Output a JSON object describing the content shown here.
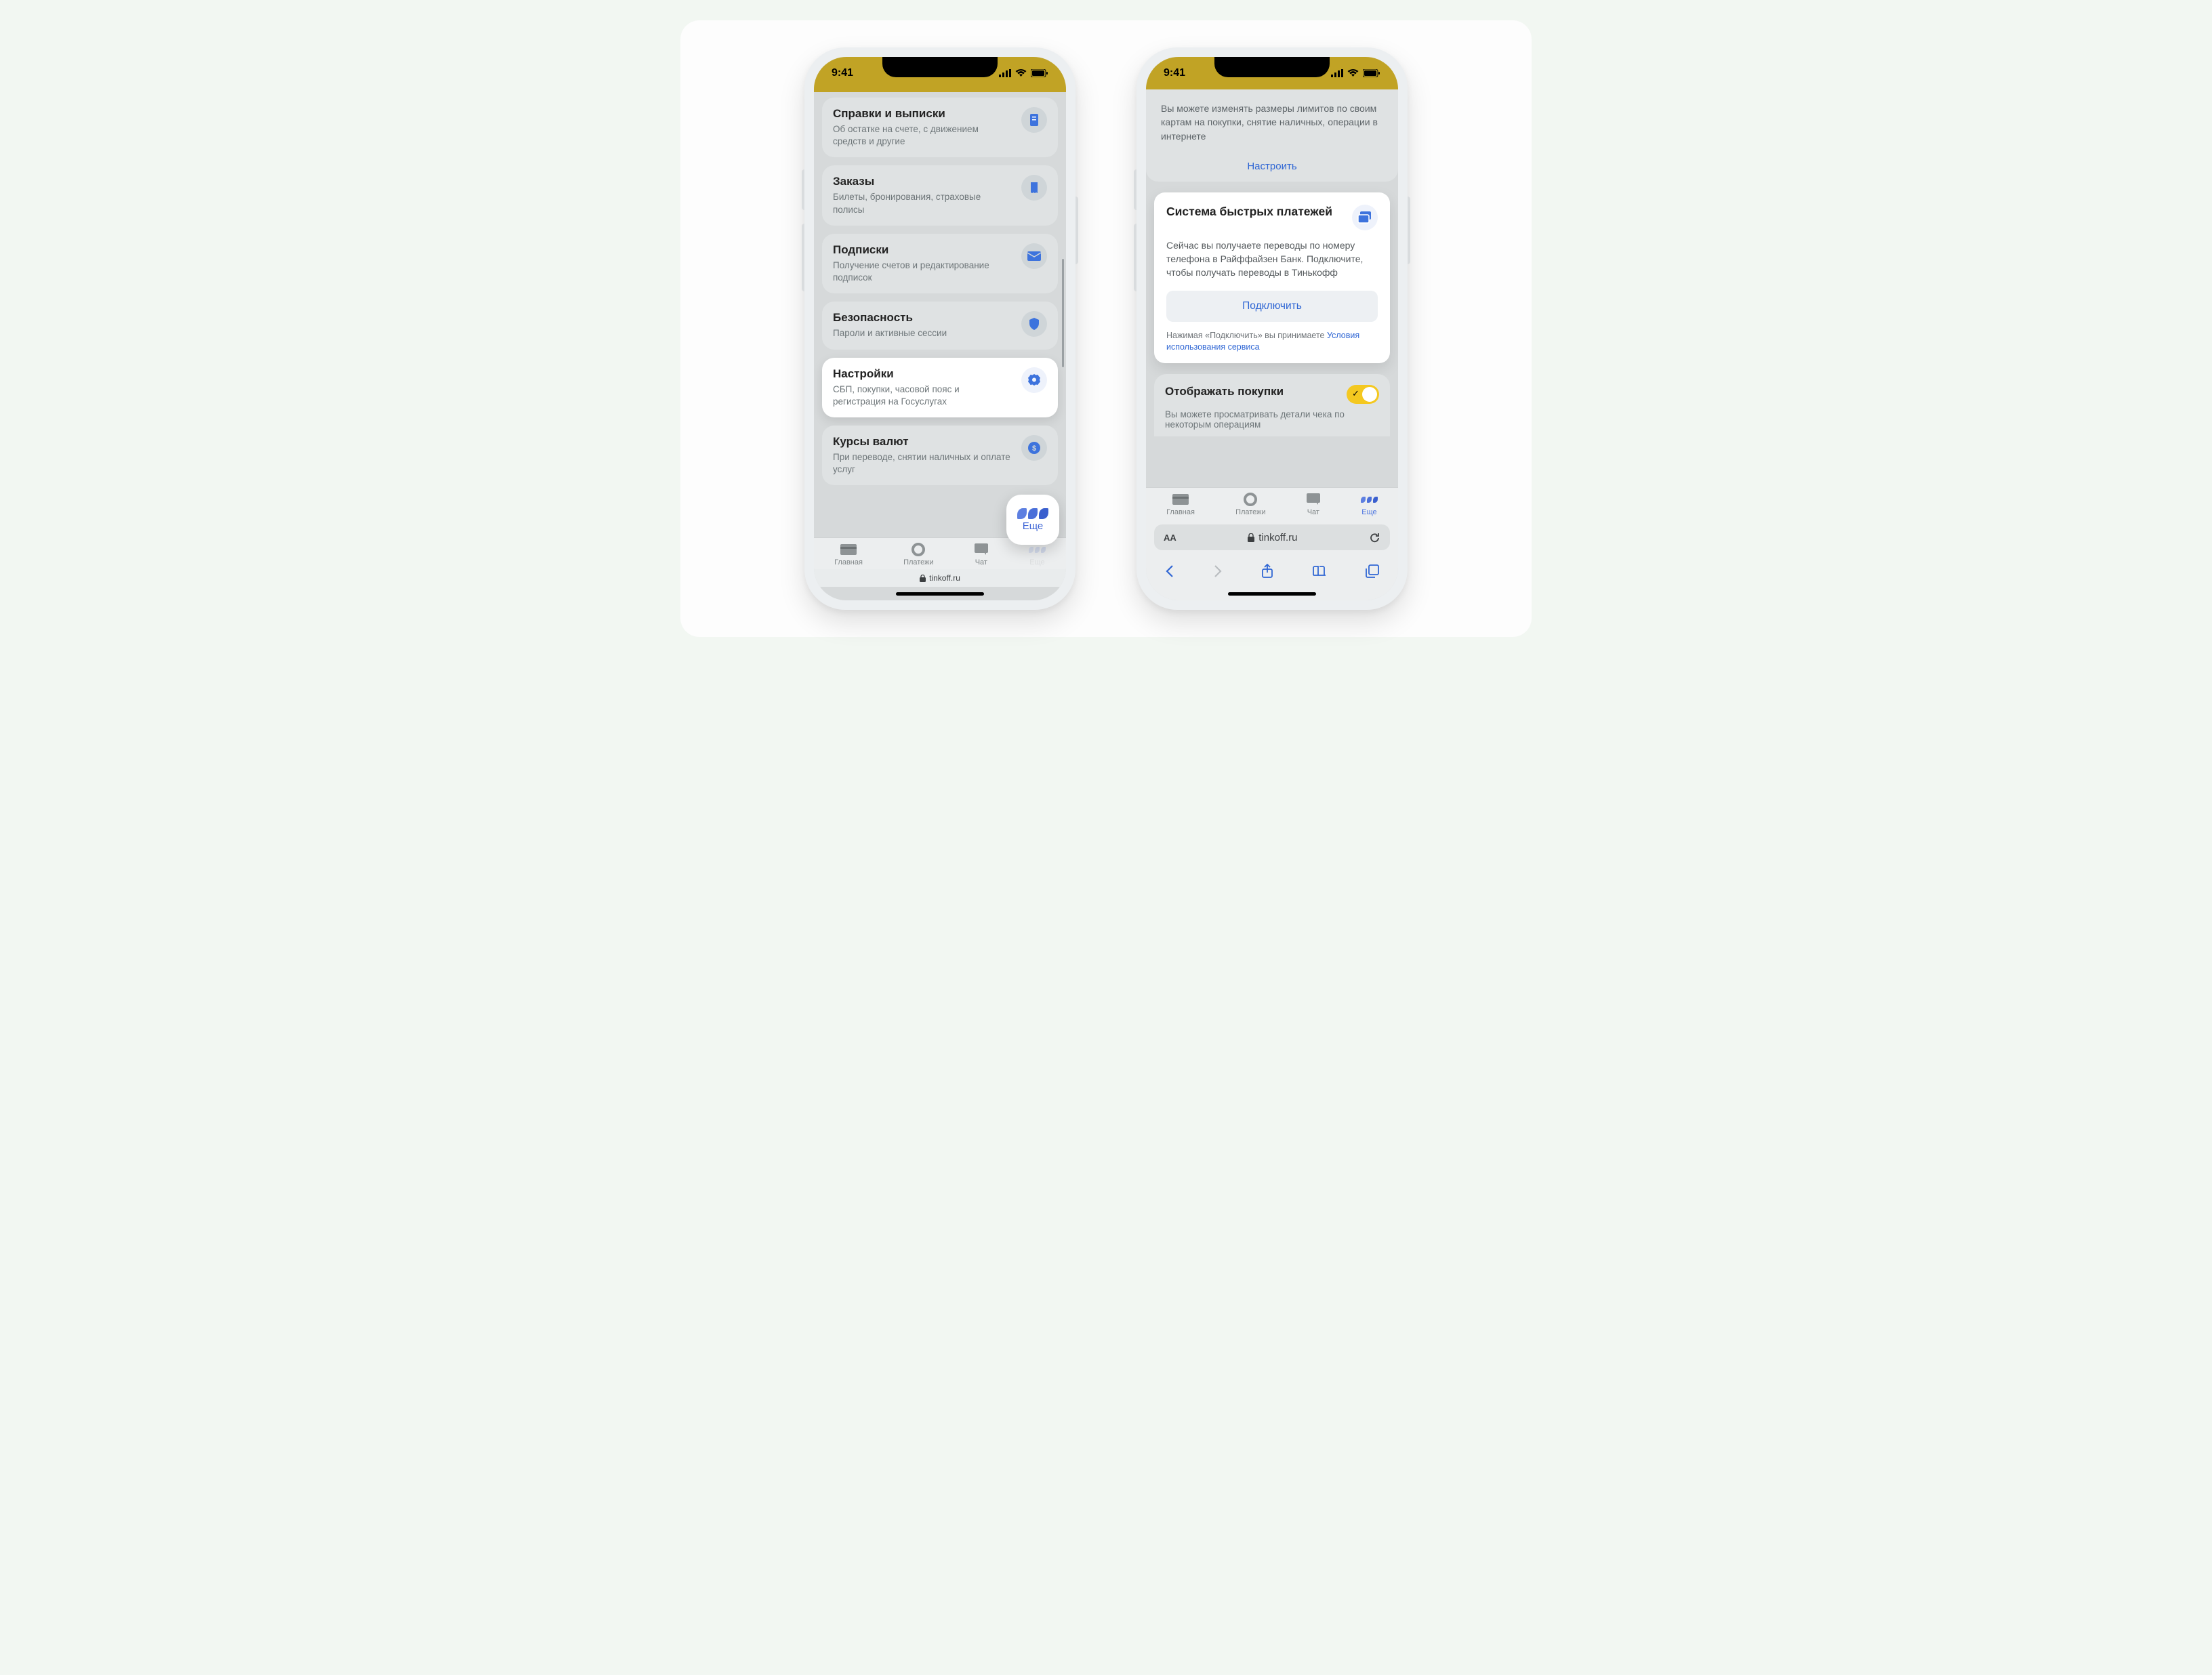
{
  "status": {
    "time": "9:41"
  },
  "phone1": {
    "cards": [
      {
        "title": "Справки и выписки",
        "sub": "Об остатке на счете, с движением средств и другие",
        "icon": "document-icon"
      },
      {
        "title": "Заказы",
        "sub": "Билеты, бронирования, страховые полисы",
        "icon": "ticket-icon"
      },
      {
        "title": "Подписки",
        "sub": "Получение счетов и редактирование подписок",
        "icon": "mail-icon"
      },
      {
        "title": "Безопасность",
        "sub": "Пароли и активные сессии",
        "icon": "shield-icon"
      },
      {
        "title": "Настройки",
        "sub": "СБП, покупки, часовой пояс и регистрация на Госуслугах",
        "icon": "gear-icon",
        "active": true
      },
      {
        "title": "Курсы валют",
        "sub": "При переводе, снятии наличных и оплате услуг",
        "icon": "currency-icon"
      }
    ],
    "float_label": "Еще",
    "addr": "tinkoff.ru"
  },
  "phone2": {
    "limits_text": "Вы можете изменять размеры лимитов по своим картам на покупки, снятие наличных, операции в интернете",
    "limits_link": "Настроить",
    "sbp_title": "Система быстрых платежей",
    "sbp_text": "Сейчас вы получаете переводы по номеру телефона в Райффайзен Банк. Подключите, чтобы получать переводы в Тинькофф",
    "sbp_button": "Подключить",
    "terms_prefix": "Нажимая «Подключить» вы принимаете ",
    "terms_link": "Условия использования сервиса",
    "toggle_title": "Отображать покупки",
    "toggle_sub": "Вы можете просматривать детали чека по некоторым операциям",
    "addr": "tinkoff.ru"
  },
  "tabs": [
    {
      "label": "Главная",
      "icon": "card-icon"
    },
    {
      "label": "Платежи",
      "icon": "circle-icon"
    },
    {
      "label": "Чат",
      "icon": "chat-icon"
    },
    {
      "label": "Еще",
      "icon": "more-icon"
    }
  ]
}
